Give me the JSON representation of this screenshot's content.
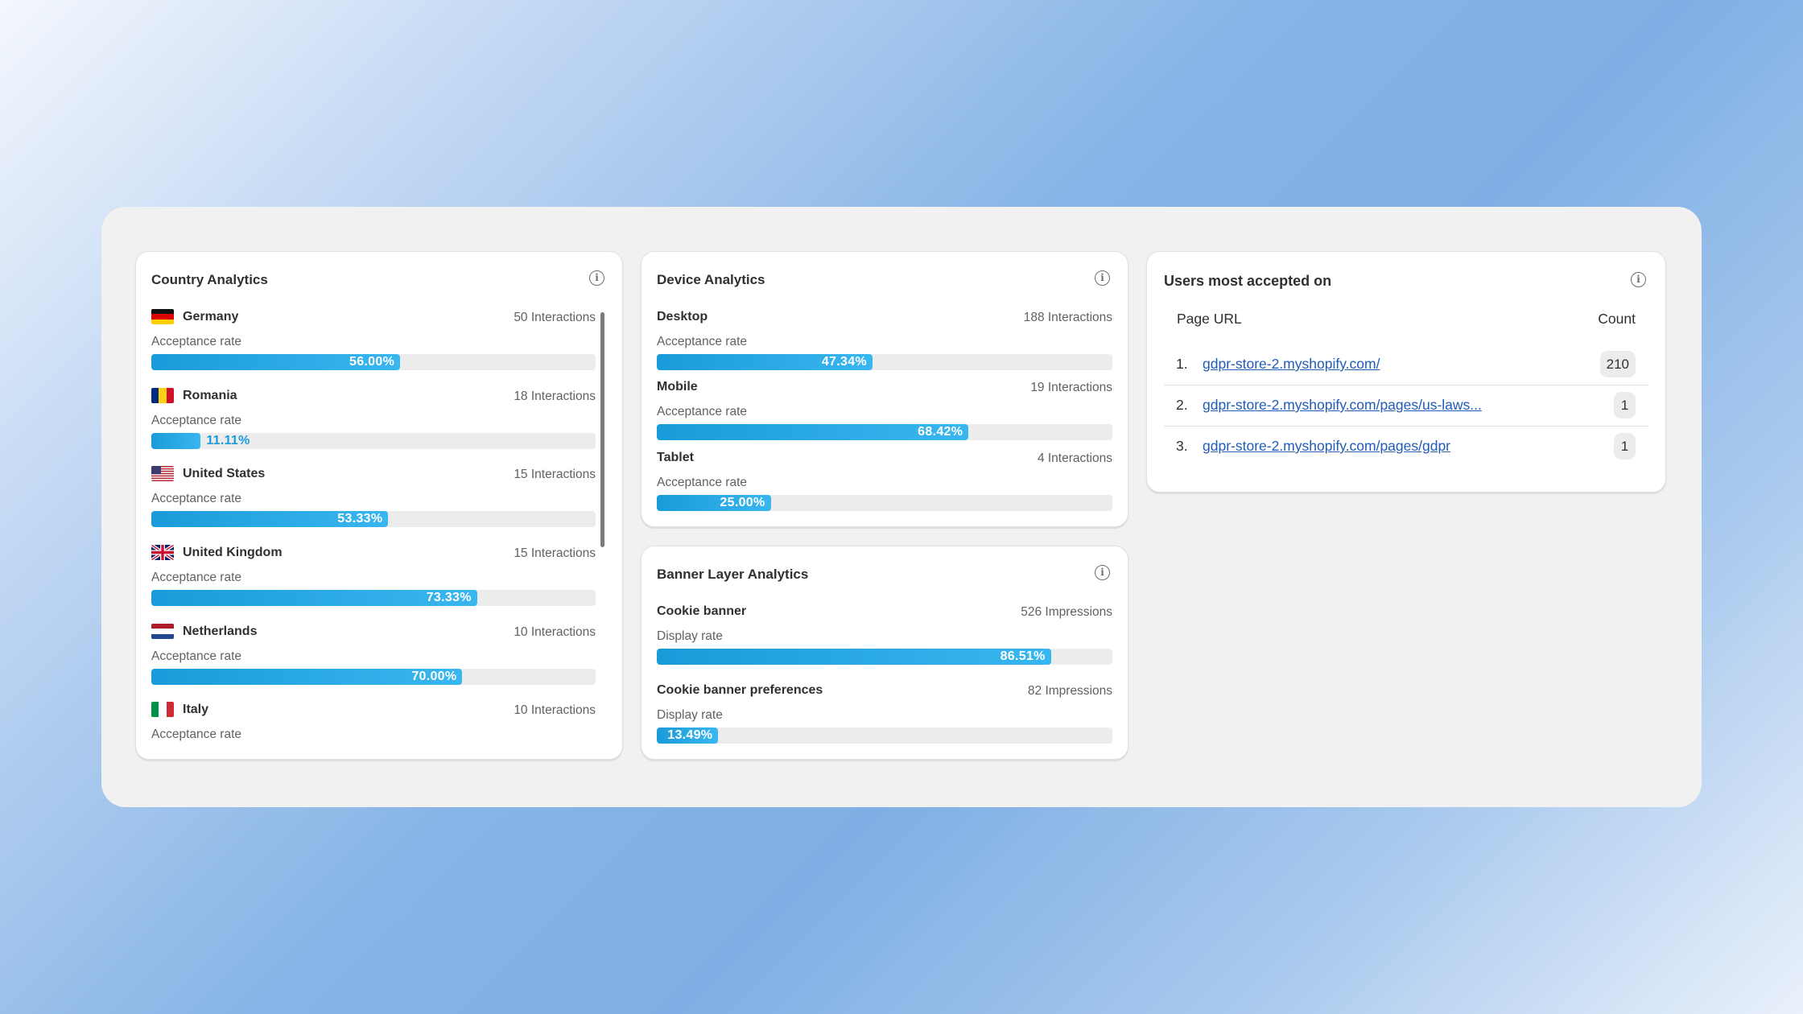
{
  "country_analytics": {
    "title": "Country Analytics",
    "rate_label": "Acceptance rate",
    "rows": [
      {
        "country": "Germany",
        "flag": "flag-germany",
        "interactions": "50 Interactions",
        "rate": 56.0,
        "rate_label": "56.00%"
      },
      {
        "country": "Romania",
        "flag": "flag-romania",
        "interactions": "18 Interactions",
        "rate": 11.11,
        "rate_label": "11.11%"
      },
      {
        "country": "United States",
        "flag": "flag-united-states",
        "interactions": "15 Interactions",
        "rate": 53.33,
        "rate_label": "53.33%"
      },
      {
        "country": "United Kingdom",
        "flag": "flag-united-kingdom",
        "interactions": "15 Interactions",
        "rate": 73.33,
        "rate_label": "73.33%"
      },
      {
        "country": "Netherlands",
        "flag": "flag-netherlands",
        "interactions": "10 Interactions",
        "rate": 70.0,
        "rate_label": "70.00%"
      },
      {
        "country": "Italy",
        "flag": "flag-italy",
        "interactions": "10 Interactions"
      }
    ]
  },
  "device_analytics": {
    "title": "Device Analytics",
    "rate_label": "Acceptance rate",
    "rows": [
      {
        "device": "Desktop",
        "interactions": "188 Interactions",
        "rate": 47.34,
        "rate_label": "47.34%"
      },
      {
        "device": "Mobile",
        "interactions": "19 Interactions",
        "rate": 68.42,
        "rate_label": "68.42%"
      },
      {
        "device": "Tablet",
        "interactions": "4 Interactions",
        "rate": 25.0,
        "rate_label": "25.00%"
      }
    ]
  },
  "banner_analytics": {
    "title": "Banner Layer Analytics",
    "rate_label": "Display rate",
    "rows": [
      {
        "layer": "Cookie banner",
        "impressions": "526 Impressions",
        "rate": 86.51,
        "rate_label": "86.51%"
      },
      {
        "layer": "Cookie banner preferences",
        "impressions": "82 Impressions",
        "rate": 13.49,
        "rate_label": "13.49%"
      }
    ]
  },
  "most_accepted": {
    "title": "Users most accepted on",
    "col_url": "Page URL",
    "col_count": "Count",
    "rows": [
      {
        "index": "1.",
        "url": "gdpr-store-2.myshopify.com/",
        "count": "210"
      },
      {
        "index": "2.",
        "url": "gdpr-store-2.myshopify.com/pages/us-laws...",
        "count": "1"
      },
      {
        "index": "3.",
        "url": "gdpr-store-2.myshopify.com/pages/gdpr",
        "count": "1"
      }
    ]
  },
  "icons": {
    "info": "info-icon",
    "info_glyph": "i"
  },
  "colors": {
    "bar_fill": "#1a9bd9",
    "bar_track": "#ececec",
    "link": "#1f5cb8"
  }
}
